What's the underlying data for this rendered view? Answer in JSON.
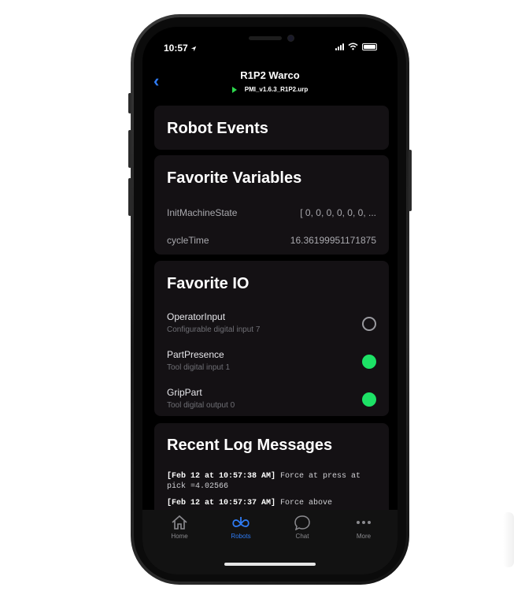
{
  "status": {
    "time": "10:57"
  },
  "header": {
    "back_label": "‹",
    "title": "R1P2 Warco",
    "program": "PMI_v1.6.3_R1P2.urp"
  },
  "robot_events": {
    "title": "Robot Events"
  },
  "favorite_variables": {
    "title": "Favorite Variables",
    "items": [
      {
        "name": "InitMachineState",
        "value": "[ 0, 0, 0, 0, 0, 0, ..."
      },
      {
        "name": "cycleTime",
        "value": "16.36199951171875"
      }
    ]
  },
  "favorite_io": {
    "title": "Favorite IO",
    "items": [
      {
        "name": "OperatorInput",
        "desc": "Configurable digital input 7",
        "state": "off"
      },
      {
        "name": "PartPresence",
        "desc": "Tool digital input 1",
        "state": "on"
      },
      {
        "name": "GripPart",
        "desc": "Tool digital output 0",
        "state": "on"
      }
    ]
  },
  "recent_logs": {
    "title": "Recent Log Messages",
    "items": [
      {
        "time": "[Feb 12 at 10:57:38 AM]",
        "text": " Force at press at pick =4.02566"
      },
      {
        "time": "[Feb 12 at 10:57:37 AM]",
        "text": " Force above"
      }
    ]
  },
  "tabs": [
    {
      "label": "Home",
      "icon": "home-icon",
      "active": false
    },
    {
      "label": "Robots",
      "icon": "robots-icon",
      "active": true
    },
    {
      "label": "Chat",
      "icon": "chat-icon",
      "active": false
    },
    {
      "label": "More",
      "icon": "more-icon",
      "active": false
    }
  ],
  "colors": {
    "accent": "#2f7cf6",
    "io_on": "#1de266",
    "play": "#2dd84d",
    "card_bg": "#141114"
  }
}
